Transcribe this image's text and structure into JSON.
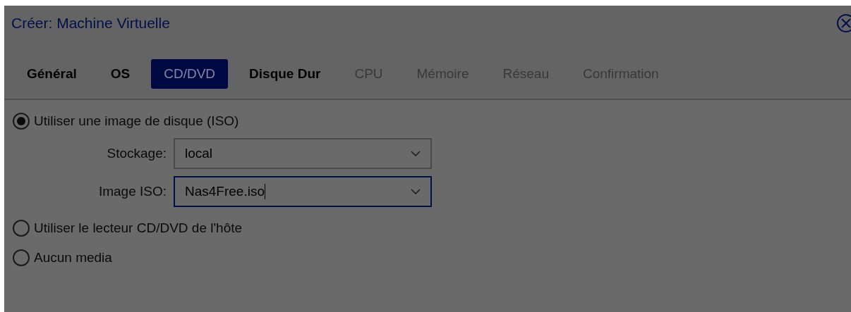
{
  "window": {
    "title": "Créer: Machine Virtuelle"
  },
  "tabs": [
    {
      "label": "Général",
      "selected": false,
      "disabled": false
    },
    {
      "label": "OS",
      "selected": false,
      "disabled": false
    },
    {
      "label": "CD/DVD",
      "selected": true,
      "disabled": false
    },
    {
      "label": "Disque Dur",
      "selected": false,
      "disabled": false
    },
    {
      "label": "CPU",
      "selected": false,
      "disabled": true
    },
    {
      "label": "Mémoire",
      "selected": false,
      "disabled": true
    },
    {
      "label": "Réseau",
      "selected": false,
      "disabled": true
    },
    {
      "label": "Confirmation",
      "selected": false,
      "disabled": true
    }
  ],
  "options": [
    {
      "label": "Utiliser une image de disque (ISO)",
      "selected": true,
      "fields": [
        {
          "label": "Stockage:",
          "value": "local",
          "focused": false
        },
        {
          "label": "Image ISO:",
          "value": "Nas4Free.iso",
          "focused": true
        }
      ]
    },
    {
      "label": "Utiliser le lecteur CD/DVD de l'hôte",
      "selected": false
    },
    {
      "label": "Aucun media",
      "selected": false
    }
  ]
}
